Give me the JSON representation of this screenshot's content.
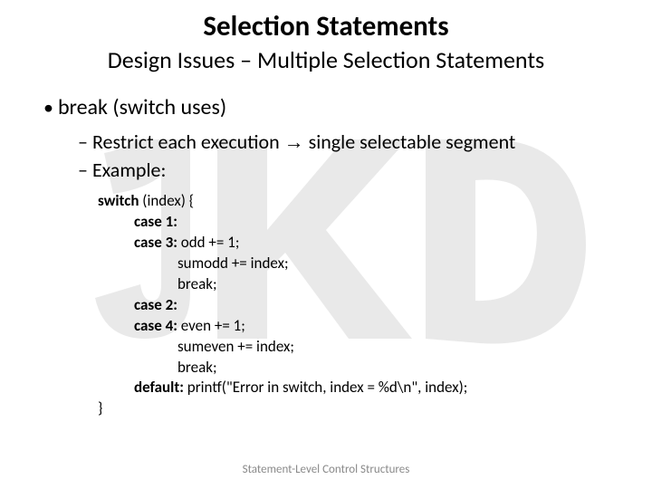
{
  "title": "Selection Statements",
  "subtitle": "Design Issues – Multiple Selection Statements",
  "bullet": {
    "main": "break (switch uses)",
    "sub1_pre": "Restrict each execution ",
    "sub1_arrow": "→",
    "sub1_post": " single selectable segment",
    "sub2": "Example:"
  },
  "code": {
    "l1_kw": "switch",
    "l1_rest": " (index) {",
    "l2_kw": "case 1:",
    "l3_kw": "case 3:",
    "l3_rest": " odd += 1;",
    "l4": "sumodd += index;",
    "l5": "break;",
    "l6_kw": "case 2:",
    "l7_kw": "case 4:",
    "l7_rest": " even += 1;",
    "l8": "sumeven += index;",
    "l9": "break;",
    "l10_kw": "default:",
    "l10_rest": " printf(\"Error in switch, index = %d\\n\", index);",
    "l11": "}"
  },
  "footer": "Statement-Level Control Structures"
}
